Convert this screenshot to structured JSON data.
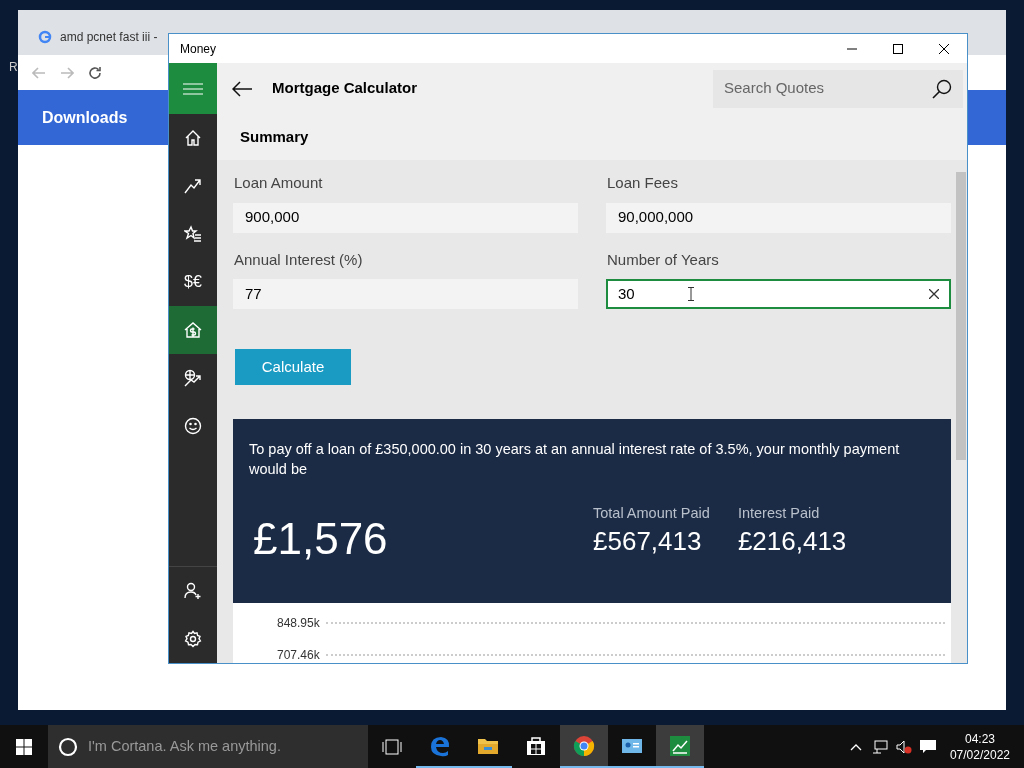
{
  "browser": {
    "tab_title": "amd pcnet fast iii -",
    "edge_letter": "R",
    "page_heading": "Downloads"
  },
  "window": {
    "title": "Money"
  },
  "sidebar": {
    "items": [
      {
        "kind": "home",
        "selected": false
      },
      {
        "kind": "trend",
        "selected": false
      },
      {
        "kind": "watchlist",
        "selected": false
      },
      {
        "kind": "currency",
        "label": "$€",
        "selected": false
      },
      {
        "kind": "mortgage",
        "selected": true
      },
      {
        "kind": "world",
        "selected": false
      },
      {
        "kind": "smiley",
        "selected": false
      }
    ],
    "footer": [
      {
        "kind": "account"
      },
      {
        "kind": "settings"
      }
    ]
  },
  "header": {
    "title": "Mortgage Calculator",
    "search": {
      "placeholder": "Search Quotes"
    }
  },
  "section": "Summary",
  "fields": [
    {
      "label": "Loan Amount",
      "value": "900,000",
      "focused": false
    },
    {
      "label": "Loan Fees",
      "value": "90,000,000",
      "focused": false
    },
    {
      "label": "Annual Interest (%)",
      "value": "77",
      "focused": false
    },
    {
      "label": "Number of Years",
      "value": "30",
      "focused": true
    }
  ],
  "calculate_button": "Calculate",
  "result": {
    "sentence": "To pay off a loan of £350,000.00 in 30 years at an annual interest rate of 3.5%, your monthly payment would be",
    "monthly": "£1,576",
    "stats": [
      {
        "label": "Total Amount Paid",
        "value": "£567,413"
      },
      {
        "label": "Interest Paid",
        "value": "£216,413"
      }
    ]
  },
  "chart": {
    "y_labels": [
      "848.95k",
      "707.46k"
    ]
  },
  "taskbar": {
    "search_placeholder": "I'm Cortana. Ask me anything.",
    "apps": [
      {
        "kind": "edge",
        "running": true,
        "active": false
      },
      {
        "kind": "explorer",
        "running": true,
        "active": false
      },
      {
        "kind": "store",
        "running": false,
        "active": false
      },
      {
        "kind": "chrome",
        "running": true,
        "active": true
      },
      {
        "kind": "contacts",
        "running": true,
        "active": false
      },
      {
        "kind": "money",
        "running": true,
        "active": true
      }
    ],
    "time": "04:23",
    "date": "07/02/2022"
  }
}
